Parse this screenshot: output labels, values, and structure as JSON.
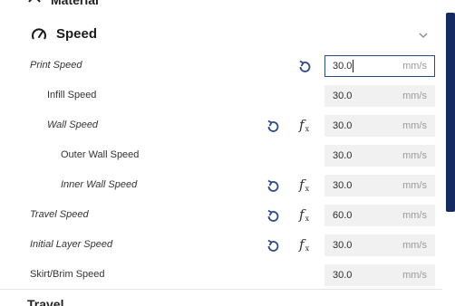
{
  "top_section": {
    "title": "Material"
  },
  "speed_section": {
    "title": "Speed",
    "rows": [
      {
        "label": "Print Speed",
        "value": "30.0",
        "unit": "mm/s",
        "italic": true,
        "reset": true,
        "fx": false,
        "focused": true
      },
      {
        "label": "Infill Speed",
        "value": "30.0",
        "unit": "mm/s",
        "italic": false,
        "reset": false,
        "fx": false
      },
      {
        "label": "Wall Speed",
        "value": "30.0",
        "unit": "mm/s",
        "italic": true,
        "reset": true,
        "fx": true
      },
      {
        "label": "Outer Wall Speed",
        "value": "30.0",
        "unit": "mm/s",
        "italic": false,
        "reset": false,
        "fx": false
      },
      {
        "label": "Inner Wall Speed",
        "value": "30.0",
        "unit": "mm/s",
        "italic": true,
        "reset": true,
        "fx": true
      },
      {
        "label": "Travel Speed",
        "value": "60.0",
        "unit": "mm/s",
        "italic": true,
        "reset": true,
        "fx": true
      },
      {
        "label": "Initial Layer Speed",
        "value": "30.0",
        "unit": "mm/s",
        "italic": true,
        "reset": true,
        "fx": true
      },
      {
        "label": "Skirt/Brim Speed",
        "value": "30.0",
        "unit": "mm/s",
        "italic": false,
        "reset": false,
        "fx": false
      }
    ]
  },
  "fx_symbol": "f",
  "fx_sub": "x",
  "bottom_section": {
    "title": "Travel"
  },
  "colors": {
    "accent": "#2b4a8a",
    "scroll_thumb": "#152a63",
    "field_bg": "#f1f1f1"
  }
}
